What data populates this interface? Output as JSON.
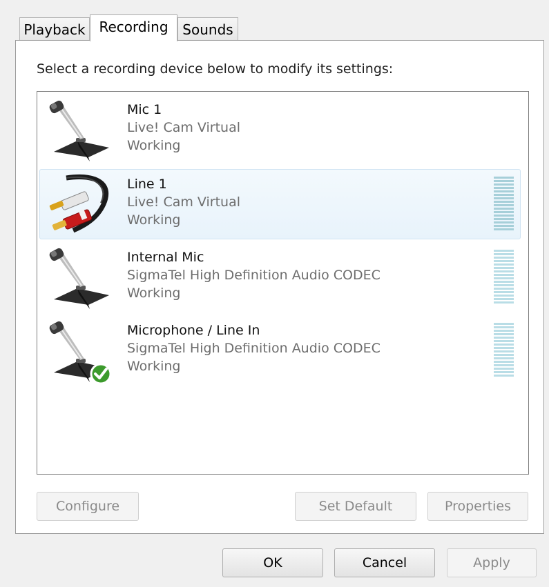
{
  "tabs": [
    {
      "label": "Playback",
      "active": false
    },
    {
      "label": "Recording",
      "active": true
    },
    {
      "label": "Sounds",
      "active": false
    }
  ],
  "instruction": "Select a recording device below to modify its settings:",
  "devices": [
    {
      "name": "Mic 1",
      "driver": "Live! Cam Virtual",
      "status": "Working",
      "icon": "microphone-icon",
      "selected": false
    },
    {
      "name": "Line 1",
      "driver": "Live! Cam Virtual",
      "status": "Working",
      "icon": "rca-cable-icon",
      "selected": true
    },
    {
      "name": "Internal Mic",
      "driver": "SigmaTel High Definition Audio CODEC",
      "status": "Working",
      "icon": "microphone-icon",
      "selected": false
    },
    {
      "name": "Microphone / Line In",
      "driver": "SigmaTel High Definition Audio CODEC",
      "status": "Working",
      "icon": "microphone-default-icon",
      "selected": false,
      "default": true
    }
  ],
  "buttons": {
    "configure": "Configure",
    "set_default": "Set Default",
    "properties": "Properties",
    "ok": "OK",
    "cancel": "Cancel",
    "apply": "Apply"
  },
  "colors": {
    "selection_background": "#e8f3fb",
    "meter": "#b9dde6",
    "default_check": "#3c9a2c"
  }
}
